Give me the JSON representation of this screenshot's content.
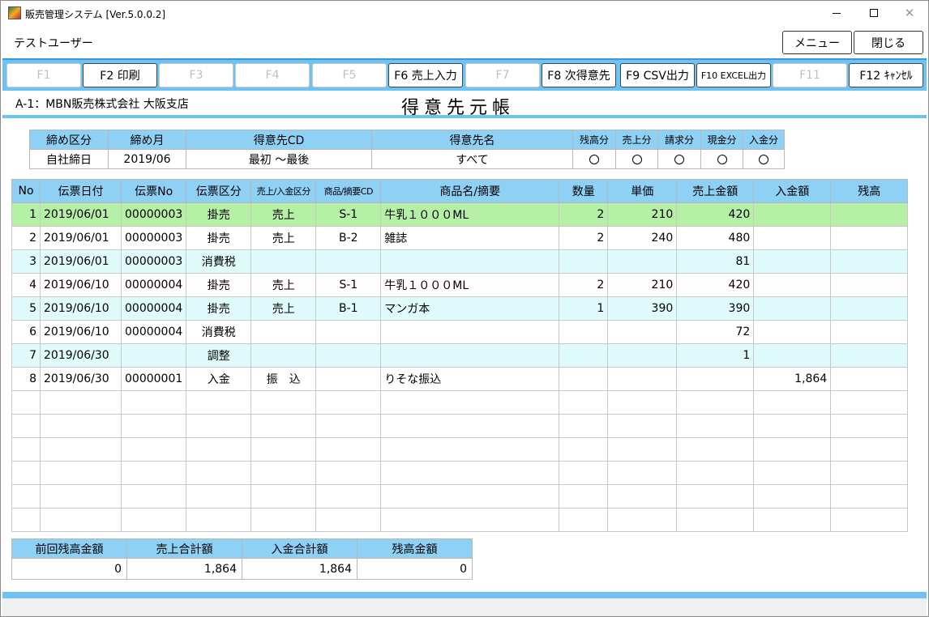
{
  "window": {
    "title": "販売管理システム [Ver.5.0.0.2]"
  },
  "user": {
    "name": "テストユーザー"
  },
  "buttons": {
    "menu": "メニュー",
    "close": "閉じる"
  },
  "fkeys": [
    {
      "label": "F1",
      "enabled": false
    },
    {
      "label": "F2 印刷",
      "enabled": true
    },
    {
      "label": "F3",
      "enabled": false
    },
    {
      "label": "F4",
      "enabled": false
    },
    {
      "label": "F5",
      "enabled": false
    },
    {
      "label": "F6 売上入力",
      "enabled": true
    },
    {
      "label": "F7",
      "enabled": false
    },
    {
      "label": "F8 次得意先",
      "enabled": true
    },
    {
      "label": "F9 CSV出力",
      "enabled": true
    },
    {
      "label": "F10 EXCEL出力",
      "enabled": true
    },
    {
      "label": "F11",
      "enabled": false
    },
    {
      "label": "F12 ｷｬﾝｾﾙ",
      "enabled": true
    }
  ],
  "company": "A-1：MBN販売株式会社 大阪支店",
  "page_title": "得意先元帳",
  "criteria": {
    "headers": [
      "締め区分",
      "締め月",
      "得意先CD",
      "得意先名",
      "残高分",
      "売上分",
      "請求分",
      "現金分",
      "入金分"
    ],
    "values": [
      "自社締日",
      "2019/06",
      "最初 ～最後",
      "すべて"
    ]
  },
  "grid": {
    "headers": [
      "No",
      "伝票日付",
      "伝票No",
      "伝票区分",
      "売上/入金区分",
      "商品/摘要CD",
      "商品名/摘要",
      "数量",
      "単価",
      "売上金額",
      "入金額",
      "残高"
    ],
    "rows": [
      [
        "1",
        "2019/06/01",
        "00000003",
        "掛売",
        "売上",
        "S-1",
        "牛乳１０００ML",
        "2",
        "210",
        "420",
        "",
        ""
      ],
      [
        "2",
        "2019/06/01",
        "00000003",
        "掛売",
        "売上",
        "B-2",
        "雑誌",
        "2",
        "240",
        "480",
        "",
        ""
      ],
      [
        "3",
        "2019/06/01",
        "00000003",
        "消費税",
        "",
        "",
        "",
        "",
        "",
        "81",
        "",
        ""
      ],
      [
        "4",
        "2019/06/10",
        "00000004",
        "掛売",
        "売上",
        "S-1",
        "牛乳１０００ML",
        "2",
        "210",
        "420",
        "",
        ""
      ],
      [
        "5",
        "2019/06/10",
        "00000004",
        "掛売",
        "売上",
        "B-1",
        "マンガ本",
        "1",
        "390",
        "390",
        "",
        ""
      ],
      [
        "6",
        "2019/06/10",
        "00000004",
        "消費税",
        "",
        "",
        "",
        "",
        "",
        "72",
        "",
        ""
      ],
      [
        "7",
        "2019/06/30",
        "",
        "調整",
        "",
        "",
        "",
        "",
        "",
        "1",
        "",
        ""
      ],
      [
        "8",
        "2019/06/30",
        "00000001",
        "入金",
        "振　込",
        "",
        "りそな振込",
        "",
        "",
        "",
        "1,864",
        ""
      ]
    ],
    "empty_rows": 6
  },
  "totals": {
    "headers": [
      "前回残高金額",
      "売上合計額",
      "入金合計額",
      "残高金額"
    ],
    "values": [
      "0",
      "1,864",
      "1,864",
      "0"
    ]
  },
  "colors": {
    "accent": "#6ec3f5",
    "header": "#8fd0f5",
    "selected_row": "#b6f0a6",
    "alt_row": "#e0fbfb"
  }
}
